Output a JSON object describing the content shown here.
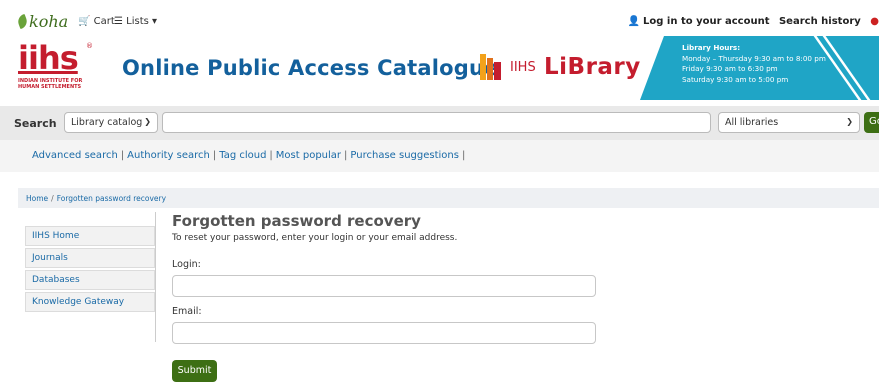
{
  "topbar": {
    "logo": "koha",
    "cart_label": "Cart",
    "lists_label": "Lists",
    "login_label": "Log in to your account",
    "search_history_label": "Search history"
  },
  "header": {
    "logo_text": "iihs",
    "logo_sub_line1": "INDIAN INSTITUTE FOR",
    "logo_sub_line2": "HUMAN SETTLEMENTS",
    "title": "Online Public Access Catalogue",
    "library_logo_prefix": "IIHS",
    "library_logo_word": "LiBrary",
    "hours": {
      "title": "Library Hours:",
      "line1": "Monday – Thursday 9:30 am to 8:00 pm",
      "line2": "Friday 9:30 am to 6:30 pm",
      "line3": "Saturday 9:30 am to 5:00 pm"
    }
  },
  "search": {
    "label": "Search",
    "scope_selected": "Library catalog",
    "query_value": "",
    "library_selected": "All libraries",
    "go_label": "Go"
  },
  "links": [
    "Advanced search",
    "Authority search",
    "Tag cloud",
    "Most popular",
    "Purchase suggestions"
  ],
  "breadcrumb": {
    "home": "Home",
    "current": "Forgotten password recovery"
  },
  "sidebar": {
    "items": [
      {
        "label": "IIHS Home"
      },
      {
        "label": "Journals"
      },
      {
        "label": "Databases"
      },
      {
        "label": "Knowledge Gateway"
      }
    ]
  },
  "form": {
    "title": "Forgotten password recovery",
    "intro": "To reset your password, enter your login or your email address.",
    "login_label": "Login:",
    "login_value": "",
    "email_label": "Email:",
    "email_value": "",
    "submit_label": "Submit"
  },
  "colors": {
    "brand_red": "#c41d2e",
    "title_blue": "#13609c",
    "link_blue": "#1a6aa6",
    "button_green": "#3d6f14",
    "hours_teal": "#1fa5c6"
  }
}
